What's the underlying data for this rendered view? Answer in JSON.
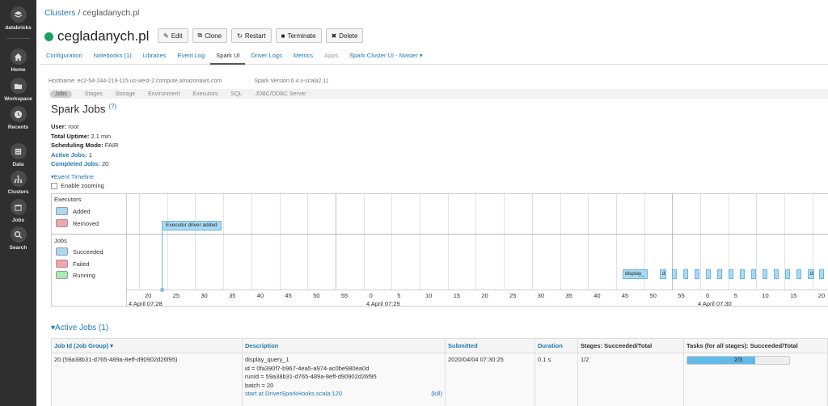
{
  "sidebar": {
    "brand": "databricks",
    "items": [
      {
        "label": "Home",
        "icon": "home-icon"
      },
      {
        "label": "Workspace",
        "icon": "folder-icon"
      },
      {
        "label": "Recents",
        "icon": "clock-icon"
      },
      {
        "label": "Data",
        "icon": "database-icon"
      },
      {
        "label": "Clusters",
        "icon": "clusters-icon"
      },
      {
        "label": "Jobs",
        "icon": "calendar-icon"
      },
      {
        "label": "Search",
        "icon": "search-icon"
      }
    ]
  },
  "breadcrumb": {
    "parent": "Clusters",
    "separator": " / ",
    "current": "cegladanych.pl"
  },
  "cluster": {
    "name": "cegladanych.pl",
    "status_color": "#1aa260"
  },
  "actions": [
    {
      "label": "Edit",
      "icon": "✎"
    },
    {
      "label": "Clone",
      "icon": "⧉"
    },
    {
      "label": "Restart",
      "icon": "↻"
    },
    {
      "label": "Terminate",
      "icon": "■"
    },
    {
      "label": "Delete",
      "icon": "✖"
    }
  ],
  "tabs": [
    {
      "label": "Configuration"
    },
    {
      "label": "Notebooks (1)"
    },
    {
      "label": "Libraries"
    },
    {
      "label": "Event Log"
    },
    {
      "label": "Spark UI",
      "active": true
    },
    {
      "label": "Driver Logs"
    },
    {
      "label": "Metrics"
    },
    {
      "label": "Apps",
      "muted": true
    },
    {
      "label": "Spark Cluster UI - Master ▾"
    }
  ],
  "host": {
    "hostname": "Hostname: ec2-54-244-219-115.us-west-2.compute.amazonaws.com",
    "version": "Spark Version:6.4.x-scala2.11"
  },
  "spark_nav": [
    "Jobs",
    "Stages",
    "Storage",
    "Environment",
    "Executors",
    "SQL",
    "JDBC/ODBC Server"
  ],
  "page": {
    "title": "Spark Jobs",
    "help": "(?)"
  },
  "summary": {
    "user_label": "User:",
    "user": "root",
    "uptime_label": "Total Uptime:",
    "uptime": "2.1 min",
    "sched_label": "Scheduling Mode:",
    "sched": "FAIR",
    "active_label": "Active Jobs:",
    "active": "1",
    "completed_label": "Completed Jobs:",
    "completed": "20"
  },
  "timeline": {
    "toggle": "▾Event Timeline",
    "zoom_label": "Enable zooming",
    "executors_title": "Executors",
    "added": "Added",
    "removed": "Removed",
    "jobs_title": "Jobs",
    "succeeded": "Succeeded",
    "failed": "Failed",
    "running": "Running",
    "executor_event": "Executor driver added",
    "first_job": "display_",
    "small_job": "d",
    "ticks": [
      "20",
      "25",
      "30",
      "35",
      "40",
      "45",
      "50",
      "55",
      "0",
      "5",
      "10",
      "15",
      "20",
      "25",
      "30",
      "35",
      "40",
      "45",
      "50",
      "55",
      "0",
      "5",
      "10",
      "15",
      "20"
    ],
    "dates": [
      "4 April 07:28",
      "4 April 07:29",
      "4 April 07:30"
    ]
  },
  "active_jobs": {
    "toggle": "▾Active Jobs (1)",
    "headers": [
      "Job Id (Job Group) ▾",
      "Description",
      "Submitted",
      "Duration",
      "Stages: Succeeded/Total",
      "Tasks (for all stages): Succeeded/Total"
    ],
    "row": {
      "job_id": "20 (59a38b31-d765-489a-8eff-d90902d26f95)",
      "desc": [
        "display_query_1",
        "id = 0fa390f7-b967-4ea5-a974-ac0be980ea0d",
        "runId = 59a38b31-d765-489a-8eff-d90902d26f95",
        "batch = 20"
      ],
      "desc_link": "start at DriverSparkHooks.scala:120",
      "kill": "(kill)",
      "submitted": "2020/04/04 07:30:25",
      "duration": "0.1 s",
      "stages": "1/2",
      "tasks": "2/3",
      "tasks_fraction": 0.667
    }
  }
}
